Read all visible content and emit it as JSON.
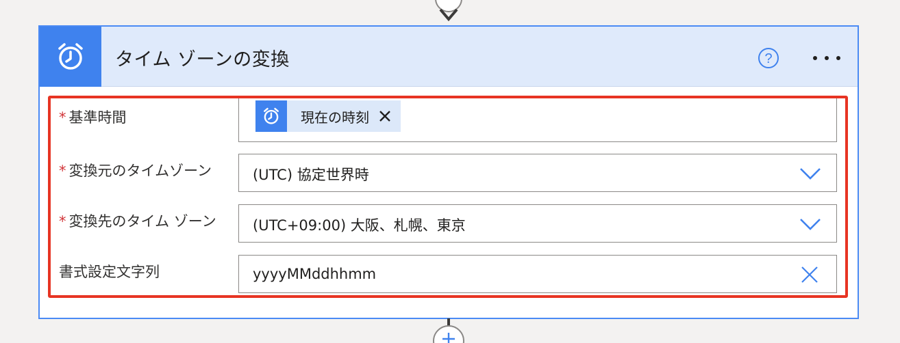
{
  "card": {
    "title": "タイム ゾーンの変換",
    "header_icon": "alarm-clock-icon",
    "help_icon": "help-circle-icon",
    "more_icon": "ellipsis-icon"
  },
  "fields": {
    "base_time": {
      "required_marker": "*",
      "label": "基準時間",
      "token_icon": "alarm-clock-icon",
      "token_label": "現在の時刻",
      "token_remove_icon": "close-icon"
    },
    "source_timezone": {
      "required_marker": "*",
      "label": "変換元のタイムゾーン",
      "value": "(UTC) 協定世界時"
    },
    "target_timezone": {
      "required_marker": "*",
      "label": "変換先のタイム ゾーン",
      "value": "(UTC+09:00) 大阪、札幌、東京"
    },
    "format_string": {
      "label": "書式設定文字列",
      "value": "yyyyMMddhhmm"
    }
  },
  "colors": {
    "accent": "#3f82ee",
    "card_border": "#4a8af4",
    "header_bg": "#dfeafb",
    "highlight": "#e73423",
    "required": "#d13438"
  }
}
